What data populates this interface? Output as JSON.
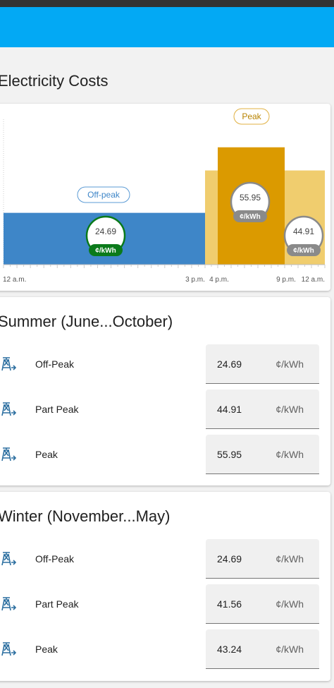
{
  "app": {
    "section_title": "Electricity Costs"
  },
  "chart_data": {
    "type": "bar",
    "categories": [
      "12 a.m.",
      "3 p.m.",
      "4 p.m.",
      "9 p.m.",
      "12 a.m."
    ],
    "periods": [
      {
        "name": "Off-peak",
        "start_hour": 0,
        "end_hour": 16,
        "value": 24.69,
        "unit": "¢/kWh",
        "color": "#3e86c8",
        "badge_color": "#0a7a1a"
      },
      {
        "name": "Part Peak",
        "start_hour": 15,
        "end_hour": 24,
        "value": 44.91,
        "unit": "¢/kWh",
        "color": "#f0cd6e",
        "badge_color": "#8a8a8a"
      },
      {
        "name": "Peak",
        "start_hour": 16,
        "end_hour": 21,
        "value": 55.95,
        "unit": "¢/kWh",
        "color": "#db9a00",
        "badge_color": "#8a8a8a"
      }
    ],
    "labels": {
      "off_peak": "Off-peak",
      "peak": "Peak"
    },
    "tick_labels": [
      "12 a.m.",
      "3 p.m.",
      "4 p.m.",
      "9 p.m.",
      "12 a.m."
    ],
    "ylim": [
      0,
      70
    ]
  },
  "summer": {
    "title": "Summer (June...October)",
    "rows": [
      {
        "label": "Off-Peak",
        "value": "24.69",
        "unit": "¢/kWh"
      },
      {
        "label": "Part Peak",
        "value": "44.91",
        "unit": "¢/kWh"
      },
      {
        "label": "Peak",
        "value": "55.95",
        "unit": "¢/kWh"
      }
    ]
  },
  "winter": {
    "title": "Winter (November...May)",
    "rows": [
      {
        "label": "Off-Peak",
        "value": "24.69",
        "unit": "¢/kWh"
      },
      {
        "label": "Part Peak",
        "value": "41.56",
        "unit": "¢/kWh"
      },
      {
        "label": "Peak",
        "value": "43.24",
        "unit": "¢/kWh"
      }
    ]
  },
  "colors": {
    "app_bar": "#03a9f4",
    "off_peak": "#3e86c8",
    "part_peak": "#f0cd6e",
    "peak": "#db9a00",
    "icon": "#2c6fa0"
  },
  "icons": {
    "rate": "transmission-tower-export-icon"
  }
}
